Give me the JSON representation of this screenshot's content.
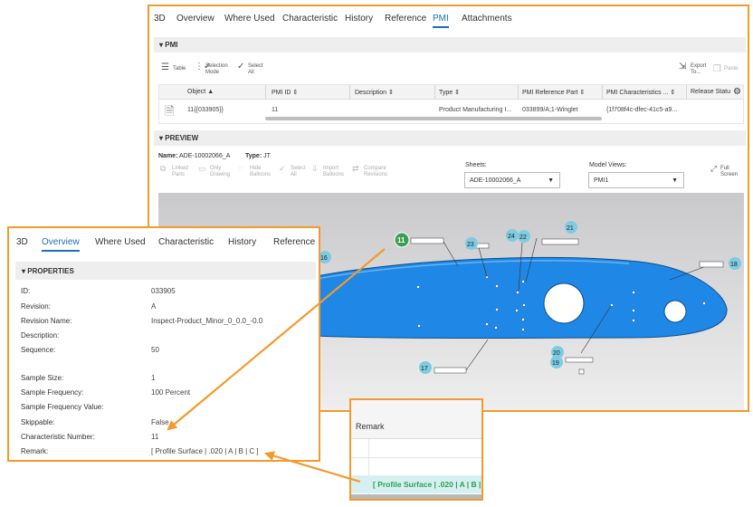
{
  "main_tabs": [
    "3D",
    "Overview",
    "Where Used",
    "Characteristic",
    "History",
    "Reference",
    "PMI",
    "Attachments"
  ],
  "pmi_section": "PMI",
  "toolbar": {
    "table": "Table",
    "selection_mode_1": "Selection",
    "selection_mode_2": "Mode",
    "select_all_1": "Select",
    "select_all_2": "All",
    "export_1": "Export",
    "export_2": "To...",
    "paste": "Paste"
  },
  "grid": {
    "headers": [
      "Object",
      "PMI ID",
      "Description",
      "Type",
      "PMI Reference Part",
      "PMI Characteristics ...",
      "Release Statu"
    ],
    "row": [
      "11{{033905}}",
      "11",
      "",
      "Product Manufacturing I...",
      "033899/A;1-Winglet",
      "{1f708f4c-dfec-41c5-a9..."
    ]
  },
  "preview_section": "PREVIEW",
  "preview_meta": {
    "name_label": "Name:",
    "name_value": "ADE-10002066_A",
    "type_label": "Type:",
    "type_value": "JT"
  },
  "viewer_tools": [
    [
      "Linked",
      "Parts"
    ],
    [
      "Only",
      "Drawing"
    ],
    [
      "Hide",
      "Balloons"
    ],
    [
      "Select",
      "All"
    ],
    [
      "Import",
      "Balloons"
    ],
    [
      "Compare",
      "Revisions"
    ]
  ],
  "sheets": {
    "label": "Sheets:",
    "value": "ADE-10002066_A"
  },
  "model_views": {
    "label": "Model Views:",
    "value": "PMI1"
  },
  "full_screen": [
    "Full",
    "Screen"
  ],
  "balloons": {
    "b11": "11",
    "b16": "16",
    "b17": "17",
    "b18": "18",
    "b19": "19",
    "b20": "20",
    "b21": "21",
    "b22": "22",
    "b23": "23",
    "b24": "24"
  },
  "props_tabs": [
    "3D",
    "Overview",
    "Where Used",
    "Characteristic",
    "History",
    "Reference"
  ],
  "properties": {
    "title": "PROPERTIES",
    "rows": [
      {
        "label": "ID:",
        "value": "033905"
      },
      {
        "label": "Revision:",
        "value": "A"
      },
      {
        "label": "Revision Name:",
        "value": "Inspect-Product_Minor_0_0.0_-0.0"
      },
      {
        "label": "Description:",
        "value": ""
      },
      {
        "label": "Sequence:",
        "value": "50"
      },
      {
        "label": "Sample Size:",
        "value": "1"
      },
      {
        "label": "Sample Frequency:",
        "value": "100 Percent"
      },
      {
        "label": "Sample Frequency Value:",
        "value": ""
      },
      {
        "label": "Skippable:",
        "value": "False"
      },
      {
        "label": "Characteristic Number:",
        "value": "11"
      },
      {
        "label": "Remark:",
        "value": "[ Profile Surface | .020 | A | B | C ]"
      }
    ]
  },
  "remark_panel": {
    "header": "Remark",
    "value": "[ Profile Surface | .020 | A | B | C ]"
  },
  "colors": {
    "accent": "#f29a2e",
    "link": "#1c6fb5",
    "part": "#1f87e6",
    "balloon": "#7fcbe0",
    "balloon_selected": "#3d9e52",
    "remark_text": "#2e9e54"
  }
}
